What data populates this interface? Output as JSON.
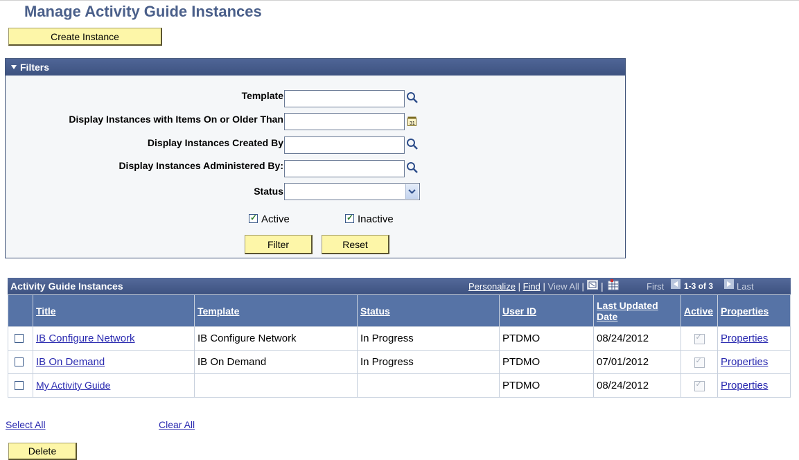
{
  "page": {
    "title": "Manage Activity Guide Instances"
  },
  "toolbar": {
    "create_label": "Create Instance"
  },
  "filters": {
    "header": "Filters",
    "template_label": "Template",
    "template_value": "",
    "older_label": "Display Instances with Items On or Older Than",
    "older_value": "",
    "created_label": "Display Instances Created By",
    "created_value": "",
    "admin_label": "Display Instances Administered By:",
    "admin_value": "",
    "status_label": "Status",
    "status_value": "",
    "active_label": "Active",
    "active_checked": true,
    "inactive_label": "Inactive",
    "inactive_checked": true,
    "filter_button": "Filter",
    "reset_button": "Reset"
  },
  "grid": {
    "title": "Activity Guide Instances",
    "personalize": "Personalize",
    "sep1": "|",
    "find": "Find",
    "sep2": "|",
    "view_all": "View All",
    "sep3": "|",
    "sep4": "|",
    "first": "First",
    "range": "1-3 of 3",
    "last": "Last",
    "columns": {
      "title": "Title",
      "template": "Template",
      "status": "Status",
      "user_id": "User ID",
      "last_updated": "Last Updated Date",
      "active": "Active",
      "properties": "Properties"
    },
    "rows": [
      {
        "title": "IB Configure Network",
        "template": "IB Configure Network",
        "status": "In Progress",
        "user_id": "PTDMO",
        "date": "08/24/2012",
        "properties": "Properties"
      },
      {
        "title": "IB On Demand",
        "template": "IB On Demand",
        "status": "In Progress",
        "user_id": "PTDMO",
        "date": "07/01/2012",
        "properties": "Properties"
      },
      {
        "title": "My Activity Guide",
        "template": "",
        "status": "",
        "user_id": "PTDMO",
        "date": "08/24/2012",
        "properties": "Properties"
      }
    ]
  },
  "footer": {
    "select_all": "Select All",
    "clear_all": "Clear All",
    "delete_button": "Delete"
  },
  "colors": {
    "title": "#4a5f8a",
    "header_bar": "#3d5280",
    "button": "#fdf6a8",
    "link": "#2a2ab0"
  }
}
